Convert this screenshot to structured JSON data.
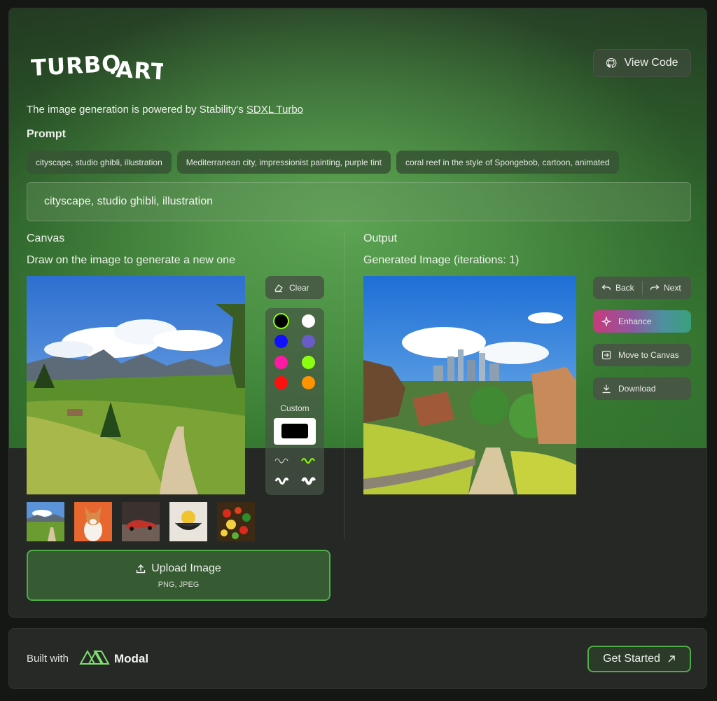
{
  "header": {
    "logo": "TURBO.ART",
    "view_code": "View Code",
    "powered_prefix": "The image generation is powered by Stability's ",
    "powered_link": "SDXL Turbo"
  },
  "prompt": {
    "label": "Prompt",
    "chips": [
      "cityscape, studio ghibli, illustration",
      "Mediterranean city, impressionist painting, purple tint",
      "coral reef in the style of Spongebob, cartoon, animated"
    ],
    "value": "cityscape, studio ghibli, illustration"
  },
  "canvas": {
    "title": "Canvas",
    "subtitle": "Draw on the image to generate a new one",
    "clear": "Clear",
    "colors": [
      "#000000",
      "#ffffff",
      "#1010ff",
      "#6a5cc8",
      "#ff1aa6",
      "#8cff10",
      "#ff1010",
      "#ff9400"
    ],
    "custom_label": "Custom",
    "upload_label": "Upload Image",
    "upload_types": "PNG, JPEG"
  },
  "output": {
    "title": "Output",
    "subtitle": "Generated Image (iterations: 1)",
    "back": "Back",
    "next": "Next",
    "enhance": "Enhance",
    "move_to_canvas": "Move to Canvas",
    "download": "Download"
  },
  "footer": {
    "built_with": "Built with",
    "brand": "Modal",
    "get_started": "Get Started"
  }
}
